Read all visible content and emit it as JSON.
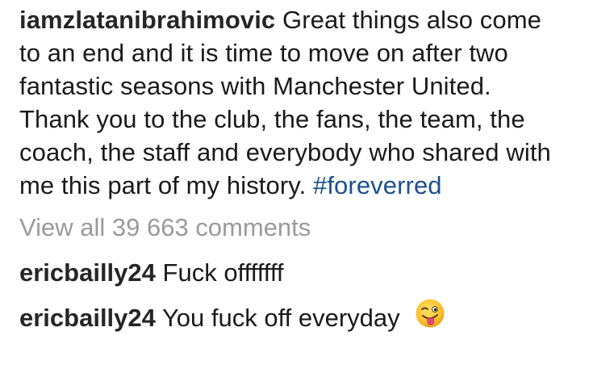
{
  "caption": {
    "username": "iamzlatanibrahimovic",
    "text": "Great things also come to an end and it is time to move on after two fantastic seasons with Manchester United. Thank you to the club, the fans, the team, the coach, the staff and everybody who shared with me this part of my history.",
    "hashtag": "#foreverred"
  },
  "view_all_comments": "View all 39 663 comments",
  "comments": [
    {
      "username": "ericbailly24",
      "text": "Fuck offfffff"
    },
    {
      "username": "ericbailly24",
      "text": "You fuck off everyday",
      "emoji": "winking-face-with-tongue-icon"
    }
  ],
  "colors": {
    "hashtag": "#1d4f8c",
    "muted": "#9a9a9a",
    "text": "#1a1a1a"
  }
}
